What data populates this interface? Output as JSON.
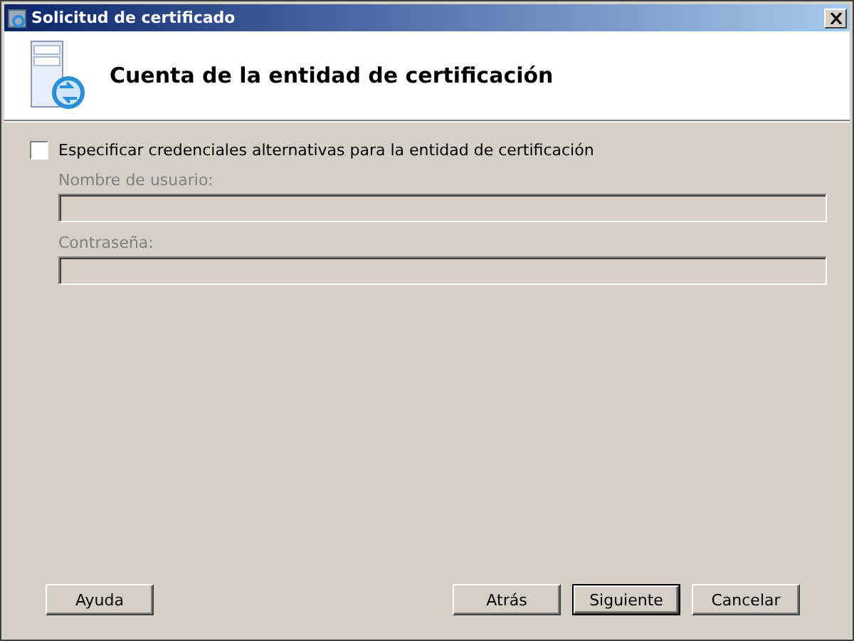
{
  "window": {
    "title": "Solicitud de certificado"
  },
  "header": {
    "title": "Cuenta de la entidad de certificación"
  },
  "option": {
    "label": "Especificar credenciales alternativas para la entidad de certificación",
    "checked": false
  },
  "fields": [
    {
      "label": "Nombre de usuario:",
      "disabled": true
    },
    {
      "label": "Contraseña:",
      "disabled": true
    }
  ],
  "left_buttons": [
    {
      "label": "Ayuda",
      "default": false
    }
  ],
  "right_buttons": [
    {
      "label": "Atrás",
      "default": false
    },
    {
      "label": "Siguiente",
      "default": true
    },
    {
      "label": "Cancelar",
      "default": false
    }
  ]
}
